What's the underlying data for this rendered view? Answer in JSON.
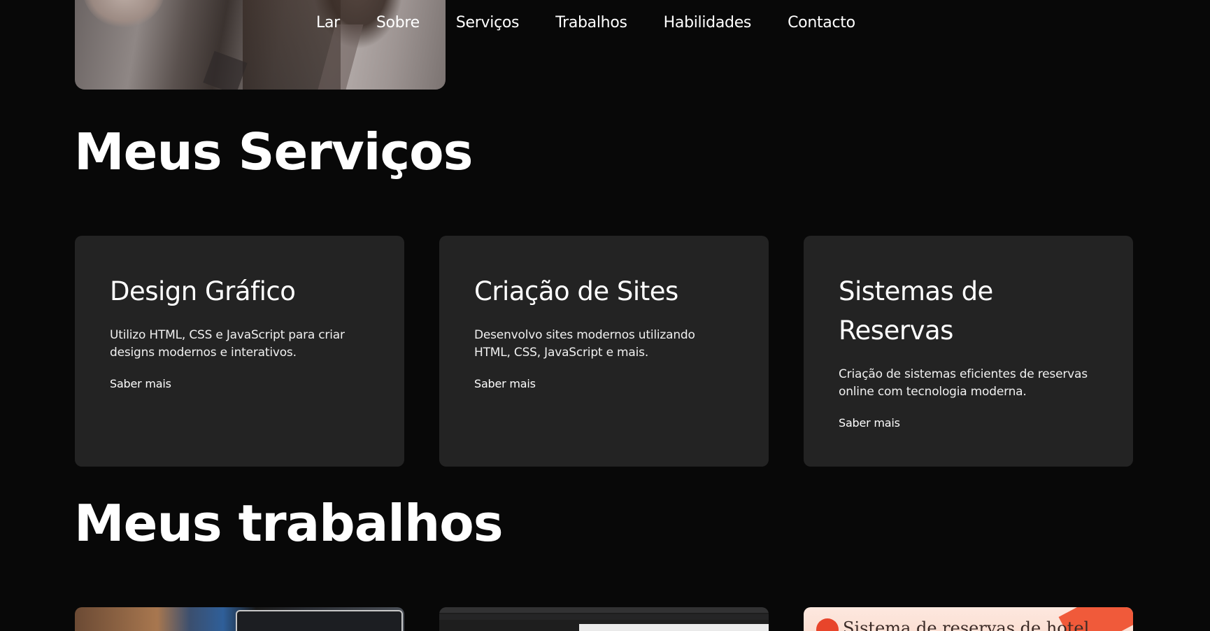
{
  "nav": {
    "items": [
      {
        "label": "Lar"
      },
      {
        "label": "Sobre"
      },
      {
        "label": "Serviços"
      },
      {
        "label": "Trabalhos"
      },
      {
        "label": "Habilidades"
      },
      {
        "label": "Contacto"
      }
    ]
  },
  "services": {
    "title": "Meus Serviços",
    "cards": [
      {
        "title": "Design Gráfico",
        "description": "Utilizo HTML, CSS e JavaScript para criar designs modernos e interativos.",
        "link": "Saber mais"
      },
      {
        "title": "Criação de Sites",
        "description": "Desenvolvo sites modernos utilizando HTML, CSS, JavaScript e mais.",
        "link": "Saber mais"
      },
      {
        "title": "Sistemas de Reservas",
        "description": "Criação de sistemas eficientes de reservas online com tecnologia moderna.",
        "link": "Saber mais"
      }
    ]
  },
  "works": {
    "title": "Meus trabalhos",
    "thumbnails": [
      {
        "caption": ""
      },
      {
        "caption": ""
      },
      {
        "caption": "Sistema de reservas de hotel"
      }
    ]
  },
  "colors": {
    "background": "#080808",
    "card": "#232323",
    "text": "#ffffff",
    "accent": "#f05a3a"
  }
}
